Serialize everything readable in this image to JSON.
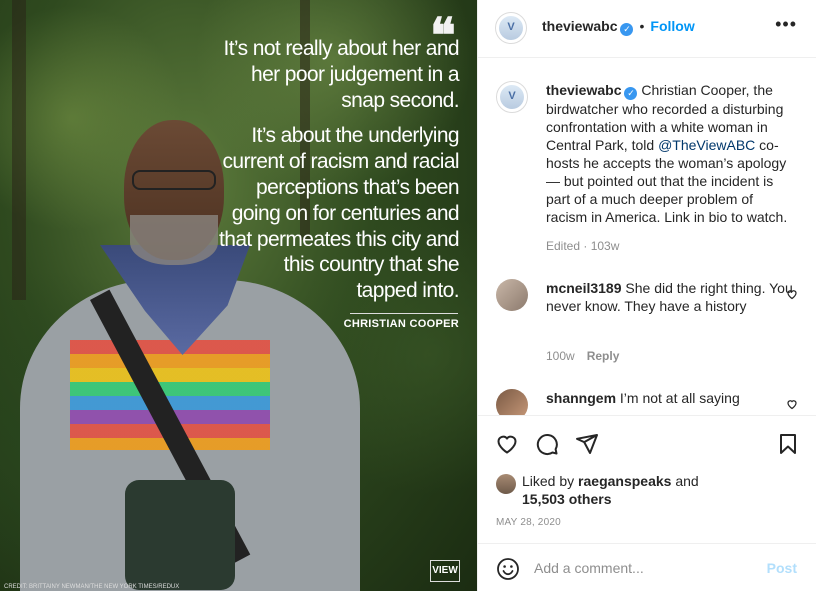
{
  "post": {
    "username": "theviewabc",
    "verified": true,
    "follow_label": "Follow",
    "more_label": "•••",
    "image": {
      "quote_mark": "❝",
      "quote_lines": [
        "It’s not really about her and her poor judgement in a snap second.",
        "It’s about the underlying current of racism and racial perceptions that’s been going on for centuries and that permeates this city and this country that she tapped into."
      ],
      "attribution": "CHRISTIAN COOPER",
      "logo_text": "VIEW",
      "credit": "CREDIT: BRITTAINY NEWMAN/THE NEW YORK TIMES/REDUX"
    }
  },
  "caption": {
    "username": "theviewabc",
    "text_before_mention": " Christian Cooper, the birdwatcher who recorded a disturbing confrontation with a white woman in Central Park, told ",
    "mention": "@TheViewABC",
    "text_after_mention": " co-hosts he accepts the woman’s apology — but pointed out that the incident is part of a much deeper problem of racism in America. Link in bio to watch.",
    "meta": "Edited · 103w"
  },
  "comments": [
    {
      "username": "mcneil3189",
      "text": " She did the right thing. You never know. They have a history",
      "time": "100w",
      "reply_label": "Reply"
    },
    {
      "username": "shanngem",
      "text": " I’m not at all saying"
    }
  ],
  "likes": {
    "prefix": "Liked by ",
    "user": "raeganspeaks",
    "middle": " and",
    "others": "15,503 others"
  },
  "date": "MAY 28, 2020",
  "add_comment": {
    "placeholder": "Add a comment...",
    "post_label": "Post"
  },
  "colors": {
    "accent": "#0095f6",
    "verified": "#3897f0",
    "post_disabled": "#b2dffc",
    "muted": "#8e8e8e"
  }
}
